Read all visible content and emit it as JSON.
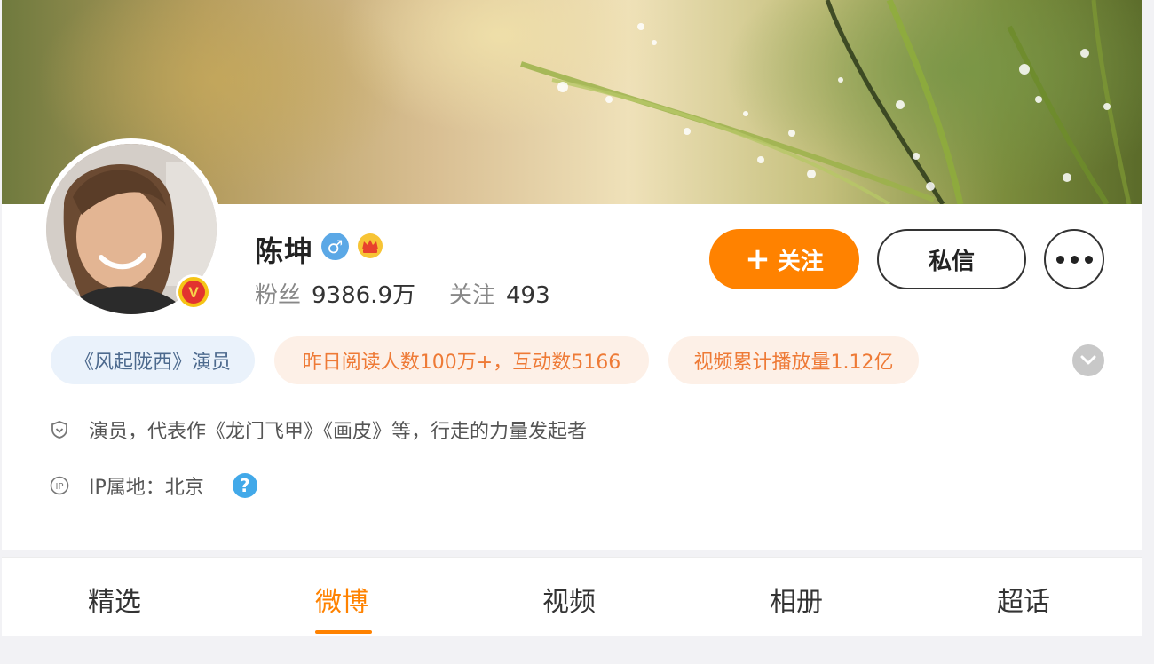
{
  "profile": {
    "name": "陈坤",
    "gender_icon": "male-icon",
    "vip_icon": "crown-vip-icon",
    "badge_letter": "V",
    "stats": {
      "fans_label": "粉丝",
      "fans_value": "9386.9万",
      "following_label": "关注",
      "following_value": "493"
    }
  },
  "actions": {
    "follow_plus": "+",
    "follow_label": "关注",
    "message_label": "私信",
    "more_icon": "more-dots-icon"
  },
  "tags": {
    "role": "《风起陇西》演员",
    "reads": "昨日阅读人数100万+，互动数5166",
    "video": "视频累计播放量1.12亿"
  },
  "info": {
    "bio": "演员，代表作《龙门飞甲》《画皮》等，行走的力量发起者",
    "ip_location": "IP属地：北京",
    "help_glyph": "?"
  },
  "tabs": [
    {
      "label": "精选"
    },
    {
      "label": "微博"
    },
    {
      "label": "视频"
    },
    {
      "label": "相册"
    },
    {
      "label": "超话"
    }
  ],
  "active_tab": "微博",
  "colors": {
    "accent": "#ff8200",
    "tag_orange_text": "#ee7a36",
    "tag_orange_bg": "#fdf0e7",
    "tag_blue_text": "#4d6a8e",
    "tag_blue_bg": "#eaf2fb"
  }
}
